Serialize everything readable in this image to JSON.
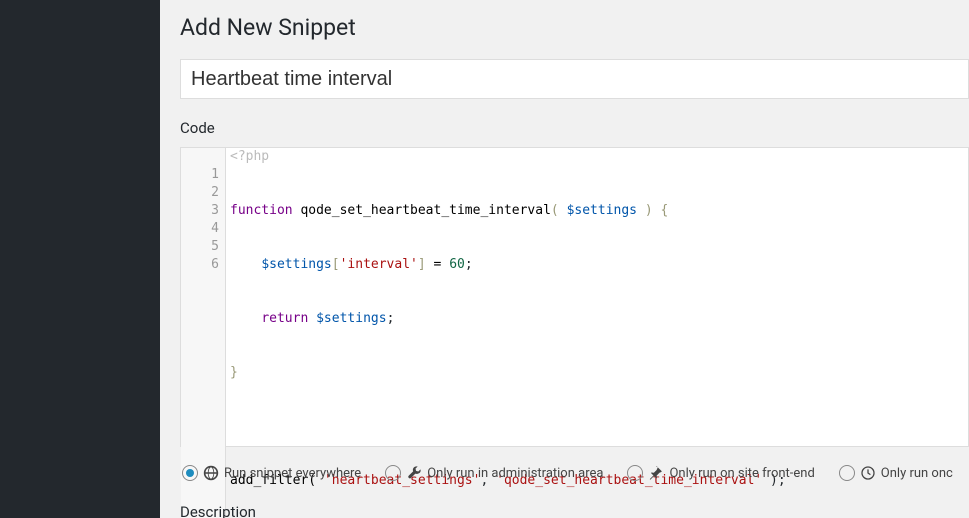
{
  "page": {
    "title": "Add New Snippet"
  },
  "form": {
    "title_value": "Heartbeat time interval",
    "code_label": "Code",
    "desc_label": "Description"
  },
  "editor": {
    "open_tag": "<?php",
    "lines": {
      "l1": {
        "a": "function",
        "b": " qode_set_heartbeat_time_interval",
        "c": "( ",
        "d": "$settings",
        "e": " ) {"
      },
      "l2": {
        "a": "    ",
        "b": "$settings",
        "c": "[",
        "d": "'interval'",
        "e": "]",
        "f": " = ",
        "g": "60",
        "h": ";"
      },
      "l3": {
        "a": "    ",
        "b": "return",
        "c": " ",
        "d": "$settings",
        "e": ";"
      },
      "l4": {
        "a": "}"
      },
      "l5": {
        "a": ""
      },
      "l6": {
        "a": "add_filter( ",
        "b": "'heartbeat_settings'",
        "c": ", ",
        "d": "'qode_set_heartbeat_time_interval'",
        "e": " );"
      }
    },
    "linenums": {
      "n1": "1",
      "n2": "2",
      "n3": "3",
      "n4": "4",
      "n5": "5",
      "n6": "6"
    }
  },
  "run_options": {
    "everywhere": "Run snippet everywhere",
    "admin": "Only run in administration area",
    "frontend": "Only run on site front-end",
    "once": "Only run onc"
  }
}
